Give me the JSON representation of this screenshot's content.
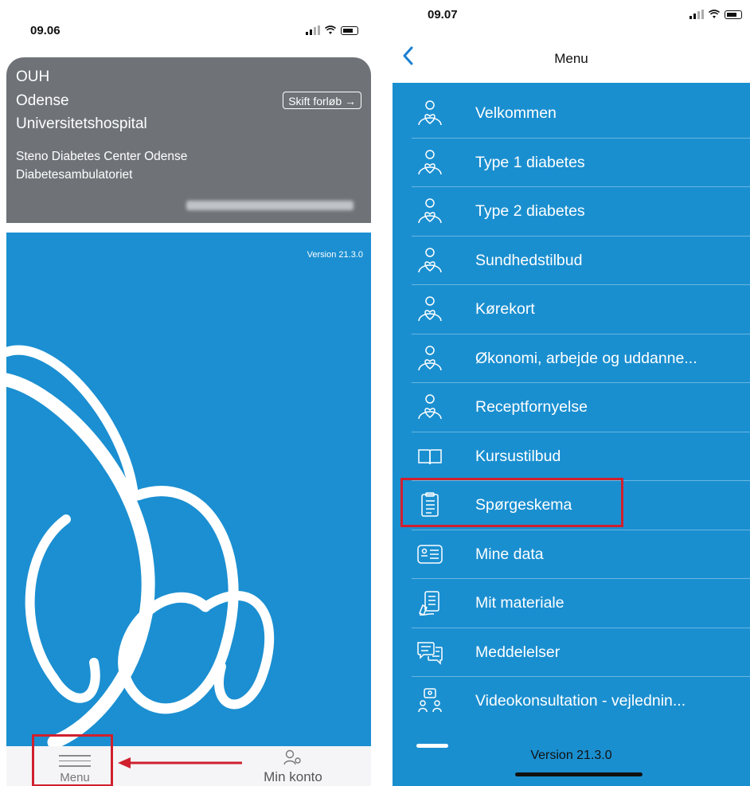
{
  "left_screen": {
    "status_bar": {
      "time": "09.06"
    },
    "header": {
      "abbr": "OUH",
      "name_line1": "Odense",
      "name_line2": "Universitetshospital",
      "department_line1": "Steno Diabetes Center Odense",
      "department_line2": "Diabetesambulatoriet",
      "switch_course_label": "Skift forløb →"
    },
    "splash": {
      "version": "Version 21.3.0"
    },
    "tab_bar": {
      "menu_label": "Menu",
      "account_label": "Min konto"
    },
    "colors": {
      "header_bg": "#6f7378",
      "splash_bg": "#1b8fd1",
      "highlight": "#d0202e"
    }
  },
  "right_screen": {
    "status_bar": {
      "time": "09.07"
    },
    "nav": {
      "back_icon": "chevron-left-icon",
      "title": "Menu"
    },
    "menu_items": [
      {
        "label": "Velkommen",
        "icon": "person-heart-icon"
      },
      {
        "label": "Type 1 diabetes",
        "icon": "person-heart-icon"
      },
      {
        "label": "Type 2 diabetes",
        "icon": "person-heart-icon"
      },
      {
        "label": "Sundhedstilbud",
        "icon": "person-heart-icon"
      },
      {
        "label": "Kørekort",
        "icon": "person-heart-icon"
      },
      {
        "label": "Økonomi, arbejde og uddanne...",
        "icon": "person-heart-icon"
      },
      {
        "label": "Receptfornyelse",
        "icon": "person-heart-icon"
      },
      {
        "label": "Kursustilbud",
        "icon": "book-icon"
      },
      {
        "label": "Spørgeskema",
        "icon": "clipboard-icon"
      },
      {
        "label": "Mine data",
        "icon": "id-card-icon"
      },
      {
        "label": "Mit materiale",
        "icon": "document-pen-icon"
      },
      {
        "label": "Meddelelser",
        "icon": "chat-bubbles-icon"
      },
      {
        "label": "Videokonsultation - vejlednin...",
        "icon": "video-consult-icon"
      }
    ],
    "version": "Version 21.3.0",
    "colors": {
      "menu_bg": "#1a8fd0",
      "highlight": "#d0202e"
    }
  }
}
